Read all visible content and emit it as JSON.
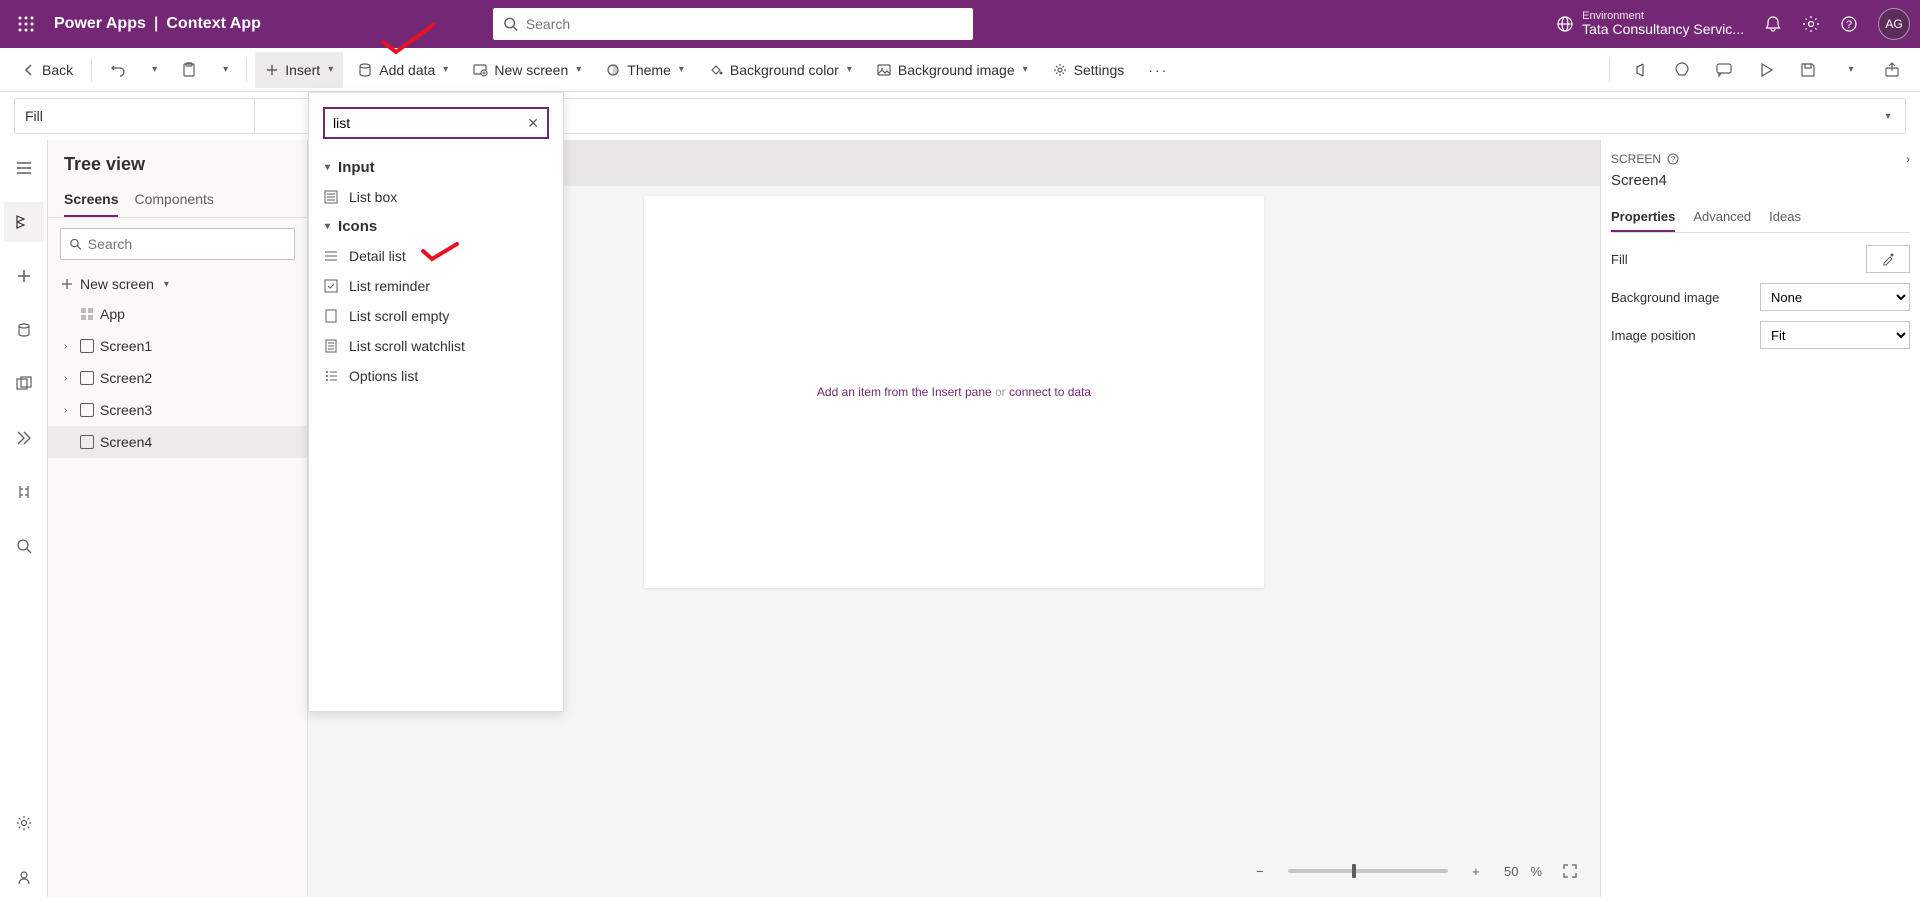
{
  "header": {
    "app_name": "Power Apps",
    "separator": "|",
    "context_name": "Context App",
    "search_placeholder": "Search",
    "env_label": "Environment",
    "env_name": "Tata Consultancy Servic...",
    "avatar_initials": "AG"
  },
  "cmdbar": {
    "back": "Back",
    "insert": "Insert",
    "add_data": "Add data",
    "new_screen": "New screen",
    "theme": "Theme",
    "bg_color": "Background color",
    "bg_image": "Background image",
    "settings": "Settings"
  },
  "formula": {
    "property": "Fill",
    "value": ""
  },
  "tree": {
    "title": "Tree view",
    "tabs": {
      "screens": "Screens",
      "components": "Components"
    },
    "search_placeholder": "Search",
    "new_screen": "New screen",
    "app_node": "App",
    "screens": [
      "Screen1",
      "Screen2",
      "Screen3",
      "Screen4"
    ]
  },
  "canvas": {
    "placeholder_pre": "Add an item from the Insert pane",
    "placeholder_or": " or ",
    "placeholder_link": "connect to data"
  },
  "properties": {
    "panel_label": "SCREEN",
    "screen_name": "Screen4",
    "tabs": {
      "properties": "Properties",
      "advanced": "Advanced",
      "ideas": "Ideas"
    },
    "fill_label": "Fill",
    "bg_image_label": "Background image",
    "bg_image_value": "None",
    "img_pos_label": "Image position",
    "img_pos_value": "Fit"
  },
  "status": {
    "zoom_value": "50",
    "zoom_pct": "%"
  },
  "insert_dropdown": {
    "search_value": "list",
    "groups": [
      {
        "name": "Input",
        "items": [
          "List box"
        ]
      },
      {
        "name": "Icons",
        "items": [
          "Detail list",
          "List reminder",
          "List scroll empty",
          "List scroll watchlist",
          "Options list"
        ]
      }
    ]
  }
}
